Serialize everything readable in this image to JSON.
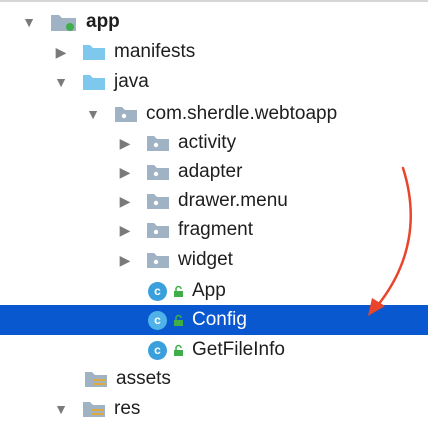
{
  "tree": {
    "items": [
      {
        "label": "app",
        "bold": true,
        "arrow": "expanded",
        "icon": "module-folder-icon"
      },
      {
        "label": "manifests",
        "arrow": "collapsed",
        "icon": "folder-icon"
      },
      {
        "label": "java",
        "arrow": "expanded",
        "icon": "folder-icon"
      },
      {
        "label": "com.sherdle.webtoapp",
        "arrow": "expanded",
        "icon": "package-icon"
      },
      {
        "label": "activity",
        "arrow": "collapsed",
        "icon": "package-icon"
      },
      {
        "label": "adapter",
        "arrow": "collapsed",
        "icon": "package-icon"
      },
      {
        "label": "drawer.menu",
        "arrow": "collapsed",
        "icon": "package-icon"
      },
      {
        "label": "fragment",
        "arrow": "collapsed",
        "icon": "package-icon"
      },
      {
        "label": "widget",
        "arrow": "collapsed",
        "icon": "package-icon"
      },
      {
        "label": "App",
        "arrow": "none",
        "icon": "class-icon",
        "class_letter": "c"
      },
      {
        "label": "Config",
        "arrow": "none",
        "icon": "class-icon",
        "class_letter": "c",
        "selected": true
      },
      {
        "label": "GetFileInfo",
        "arrow": "none",
        "icon": "class-icon",
        "class_letter": "c"
      },
      {
        "label": "assets",
        "arrow": "none",
        "icon": "resource-folder-icon"
      },
      {
        "label": "res",
        "arrow": "expanded",
        "icon": "resource-folder-icon"
      }
    ]
  },
  "colors": {
    "selection": "#0a58d0",
    "folder": "#7ec8ee",
    "annotation_arrow": "#e8452c"
  }
}
